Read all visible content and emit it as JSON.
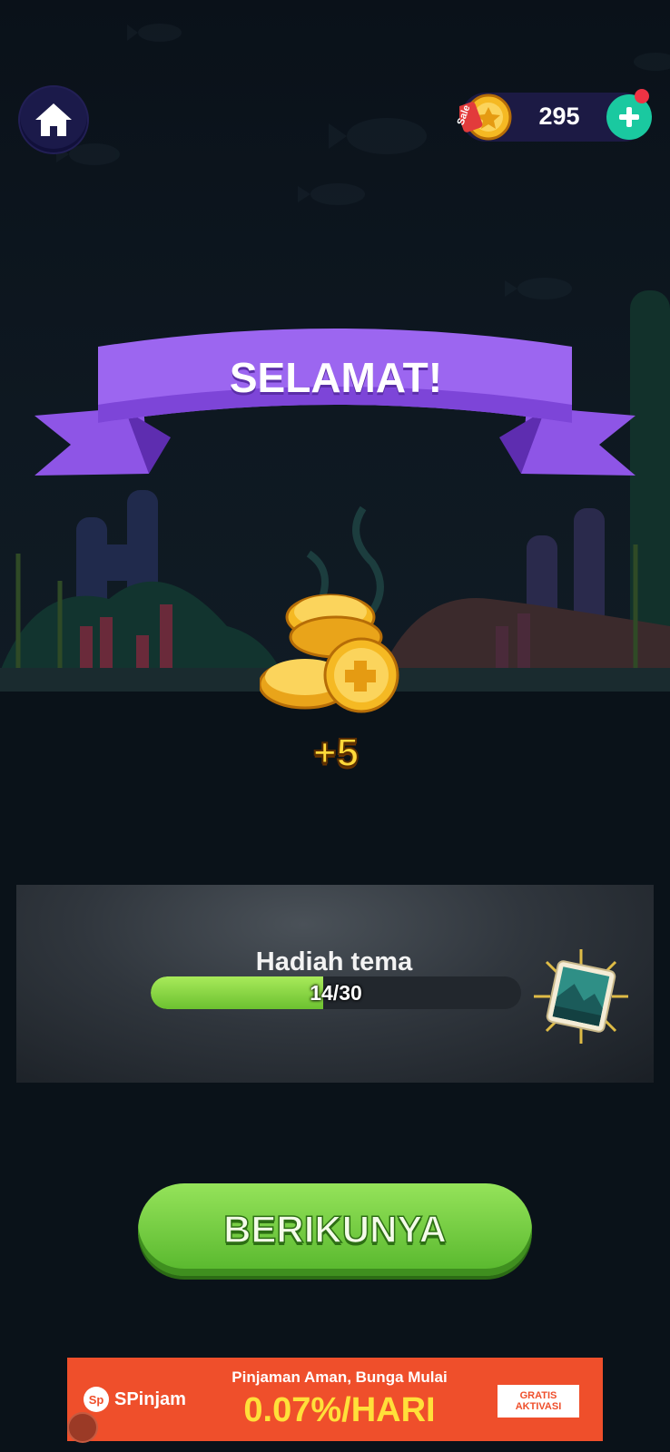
{
  "header": {
    "coin_balance": "295",
    "sale_tag": "Sale"
  },
  "banner": {
    "title": "SELAMAT!"
  },
  "reward": {
    "amount": "+5"
  },
  "theme_reward": {
    "title": "Hadiah tema",
    "progress_text": "14/30",
    "progress_current": 14,
    "progress_total": 30
  },
  "actions": {
    "next_label": "BERIKUNYA"
  },
  "ad": {
    "brand": "SPinjam",
    "line1": "Pinjaman Aman, Bunga Mulai",
    "line2": "0.07%/HARI",
    "cta": "GRATIS AKTIVASI"
  },
  "colors": {
    "background": "#0b131c",
    "banner_purple": "#8e55e6",
    "button_green": "#6cc130",
    "coin_gold": "#f5b923",
    "ad_orange": "#ef4f2b",
    "plus_teal": "#1ac9a0"
  },
  "icons": {
    "home": "home-icon",
    "coin": "coin-icon",
    "plus": "plus-icon",
    "theme": "picture-card-icon"
  }
}
